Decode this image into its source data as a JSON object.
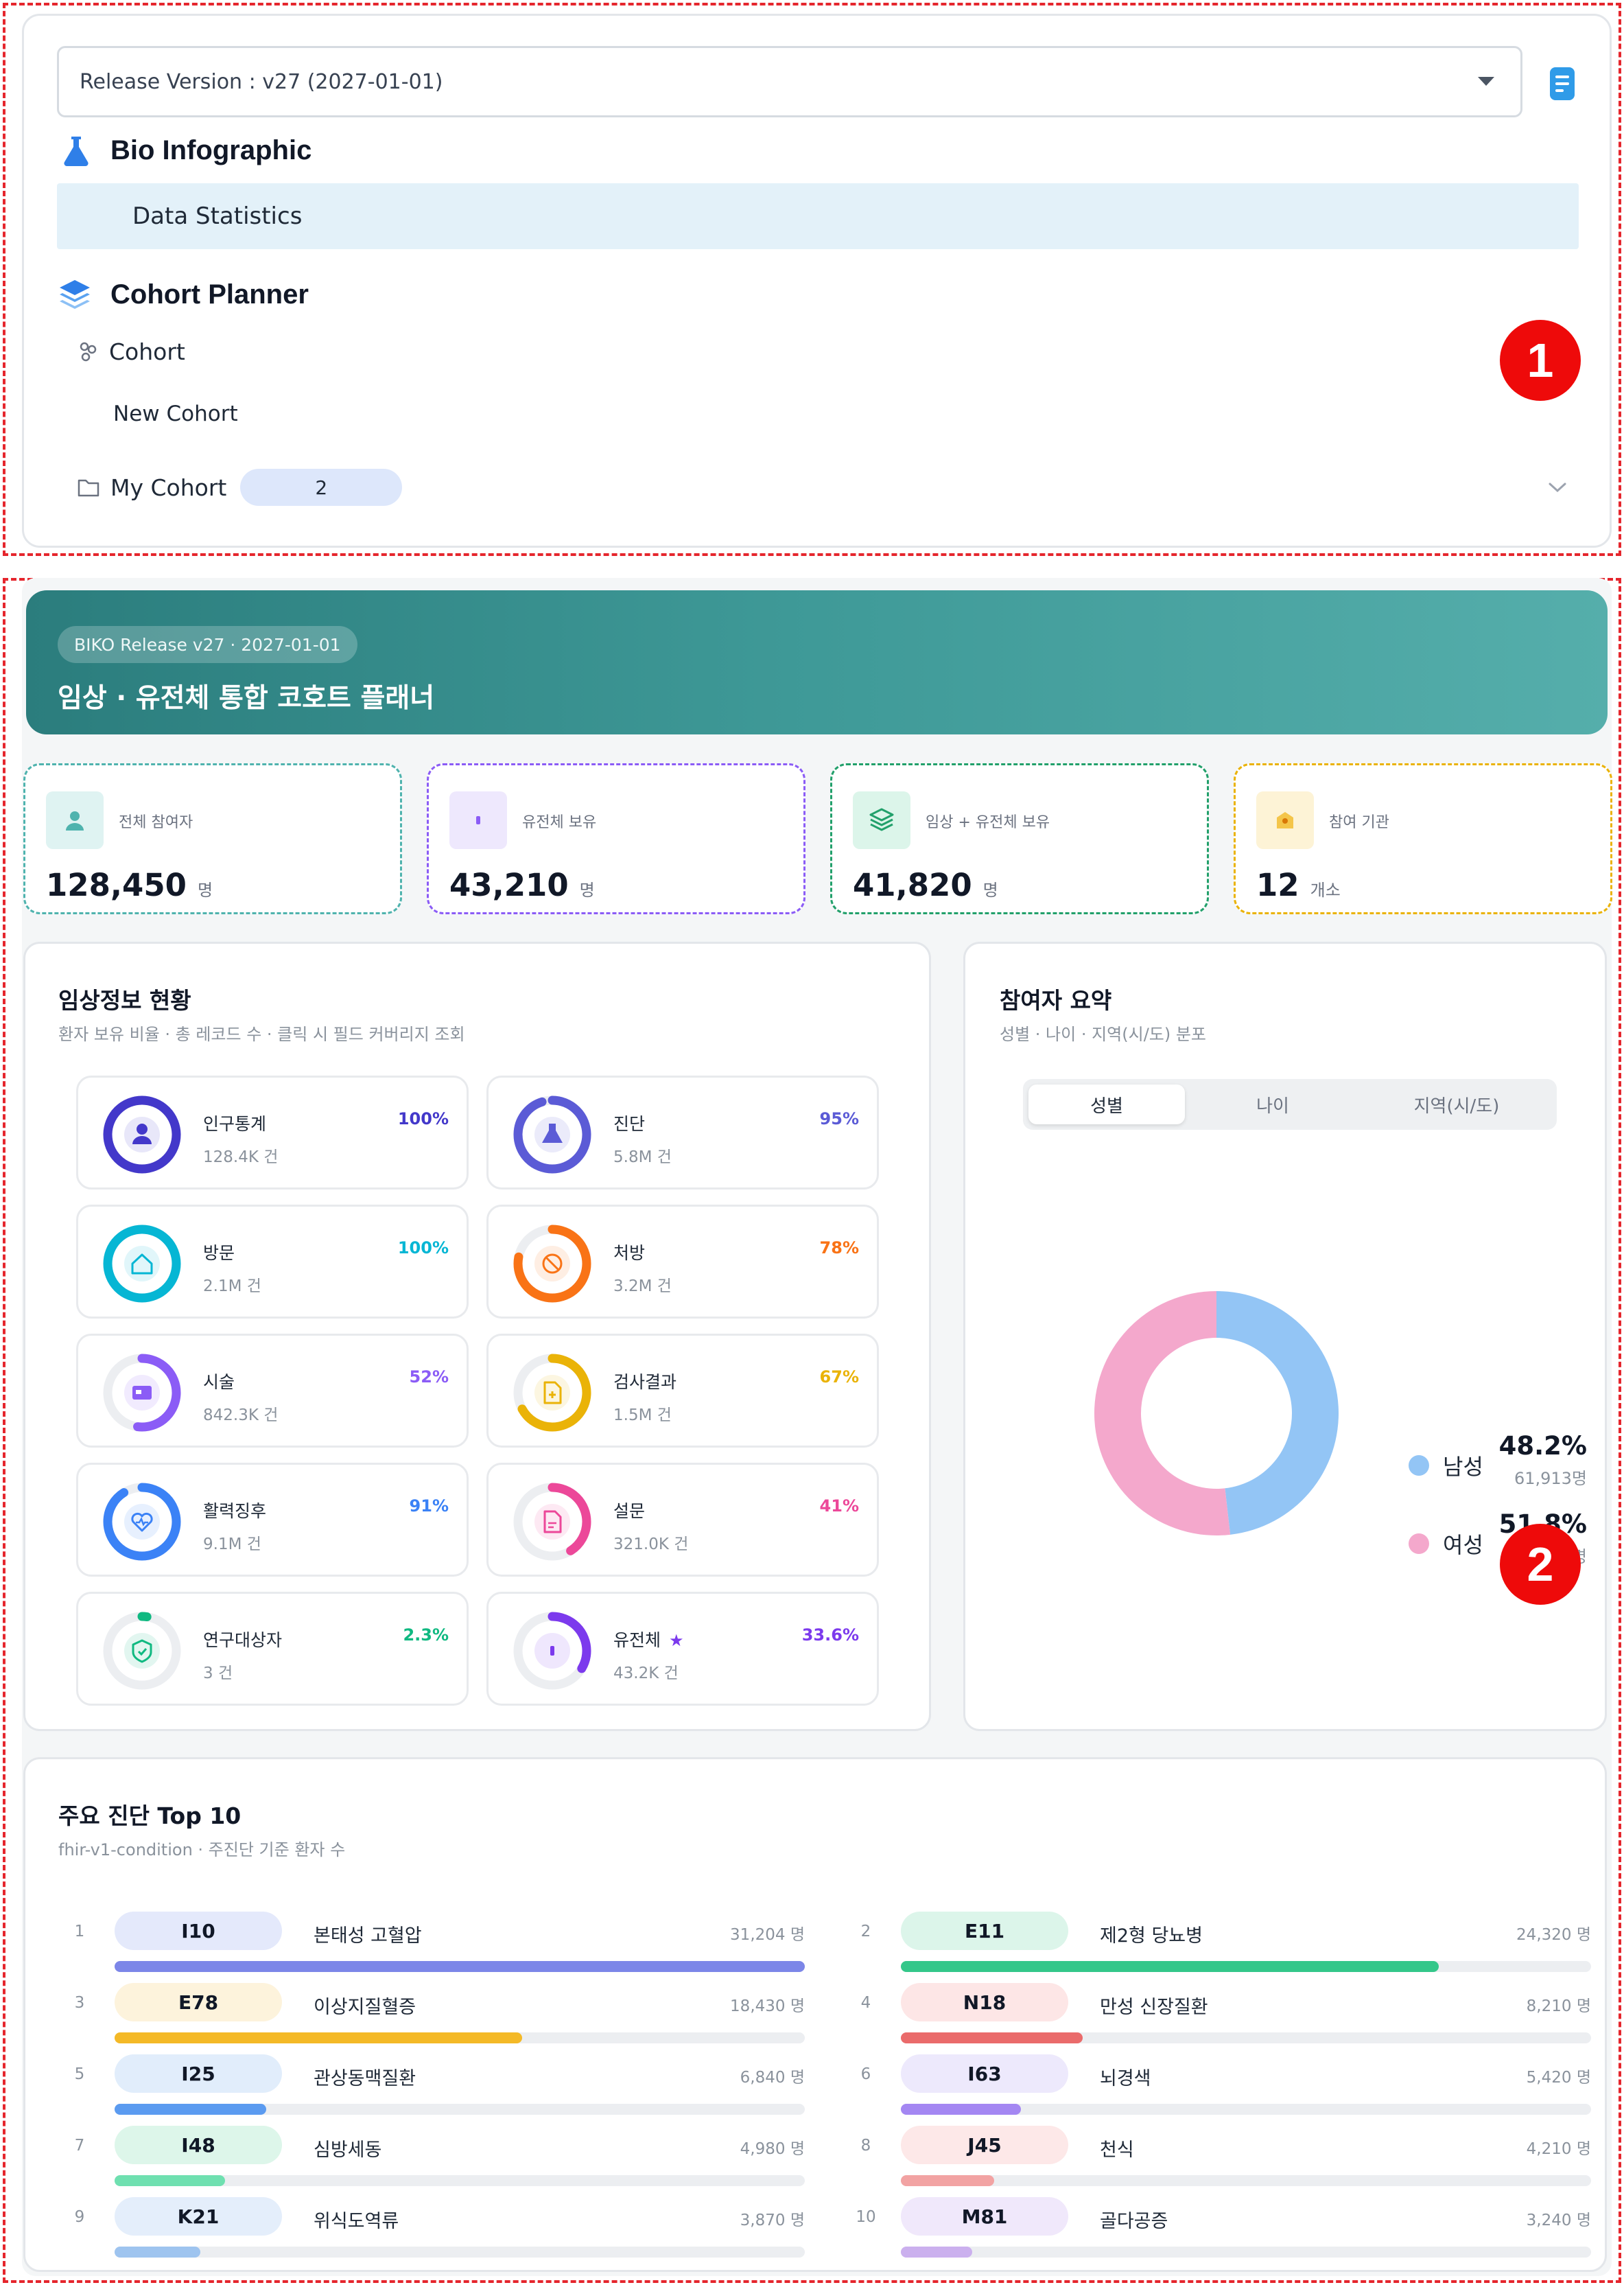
{
  "sidebar": {
    "release_select": "Release Version : v27 (2027-01-01)",
    "bio_infographic": {
      "title": "Bio Infographic",
      "items": [
        "Data Statistics"
      ]
    },
    "cohort_planner": {
      "title": "Cohort Planner",
      "cohort": "Cohort",
      "new_cohort": "New Cohort",
      "my_cohort": "My Cohort",
      "my_cohort_count": "2"
    }
  },
  "markers": {
    "one": "1",
    "two": "2"
  },
  "hero": {
    "pill": "BIKO Release v27 · 2027-01-01",
    "title": "임상 · 유전체 통합 코호트 플래너"
  },
  "stats": [
    {
      "label": "전체 참여자",
      "value": "128,450",
      "unit": "명",
      "color": "#4fb3ae"
    },
    {
      "label": "유전체 보유",
      "value": "43,210",
      "unit": "명",
      "color": "#8b5cf6"
    },
    {
      "label": "임상 + 유전체 보유",
      "value": "41,820",
      "unit": "명",
      "color": "#22a06b"
    },
    {
      "label": "참여 기관",
      "value": "12",
      "unit": "개소",
      "color": "#eab308"
    }
  ],
  "clinical": {
    "title": "임상정보 현황",
    "subtitle": "환자 보유 비율 · 총 레코드 수 · 클릭 시 필드 커버리지 조회",
    "tiles": [
      {
        "name": "인구통계",
        "count": "128.4K 건",
        "pct_label": "100%",
        "ratio": 1.0,
        "color": "#4338ca",
        "icon": "person-icon"
      },
      {
        "name": "진단",
        "count": "5.8M 건",
        "pct_label": "95%",
        "ratio": 0.95,
        "color": "#5b5bd6",
        "icon": "flask-icon"
      },
      {
        "name": "방문",
        "count": "2.1M 건",
        "pct_label": "100%",
        "ratio": 1.0,
        "color": "#06b6d4",
        "icon": "home-icon"
      },
      {
        "name": "처방",
        "count": "3.2M 건",
        "pct_label": "78%",
        "ratio": 0.78,
        "color": "#f97316",
        "icon": "prohibit-icon"
      },
      {
        "name": "시술",
        "count": "842.3K 건",
        "pct_label": "52%",
        "ratio": 0.52,
        "color": "#8b5cf6",
        "icon": "card-icon"
      },
      {
        "name": "검사결과",
        "count": "1.5M 건",
        "pct_label": "67%",
        "ratio": 0.67,
        "color": "#eab308",
        "icon": "doc-plus-icon"
      },
      {
        "name": "활력징후",
        "count": "9.1M 건",
        "pct_label": "91%",
        "ratio": 0.91,
        "color": "#3b82f6",
        "icon": "heart-pulse-icon"
      },
      {
        "name": "설문",
        "count": "321.0K 건",
        "pct_label": "41%",
        "ratio": 0.41,
        "color": "#ec4899",
        "icon": "survey-icon"
      },
      {
        "name": "연구대상자",
        "count": "3 건",
        "pct_label": "2.3%",
        "ratio": 0.023,
        "color": "#10b981",
        "icon": "shield-icon"
      },
      {
        "name": "유전체",
        "count": "43.2K 건",
        "pct_label": "33.6%",
        "ratio": 0.336,
        "color": "#7c3aed",
        "icon": "dna-icon",
        "star": "★"
      }
    ]
  },
  "participants": {
    "title": "참여자 요약",
    "subtitle": "성별 · 나이 · 지역(시/도) 분포",
    "tabs": [
      "성별",
      "나이",
      "지역(시/도)"
    ],
    "active_tab": 0,
    "donut": [
      {
        "label": "남성",
        "pct_label": "48.2%",
        "count": "61,913명",
        "ratio": 0.482,
        "color": "#93c5f5"
      },
      {
        "label": "여성",
        "pct_label": "51.8%",
        "count": "66,537명",
        "ratio": 0.518,
        "color": "#f4a8cc"
      }
    ]
  },
  "top10": {
    "title": "주요 진단 Top 10",
    "subtitle": "fhir-v1-condition · 주진단 기준 환자 수",
    "max": 31204,
    "items": [
      {
        "rank": "1",
        "code": "I10",
        "name": "본태성 고혈압",
        "count_label": "31,204 명",
        "count": 31204,
        "bg": "#e4e9fb",
        "bar": "#7c86e8"
      },
      {
        "rank": "2",
        "code": "E11",
        "name": "제2형 당뇨병",
        "count_label": "24,320 명",
        "count": 24320,
        "bg": "#dcf5ea",
        "bar": "#34c78a"
      },
      {
        "rank": "3",
        "code": "E78",
        "name": "이상지질혈증",
        "count_label": "18,430 명",
        "count": 18430,
        "bg": "#fdf3dc",
        "bar": "#f4b927"
      },
      {
        "rank": "4",
        "code": "N18",
        "name": "만성 신장질환",
        "count_label": "8,210 명",
        "count": 8210,
        "bg": "#fde6e6",
        "bar": "#ea6b6b"
      },
      {
        "rank": "5",
        "code": "I25",
        "name": "관상동맥질환",
        "count_label": "6,840 명",
        "count": 6840,
        "bg": "#e1edfb",
        "bar": "#5b9bf0"
      },
      {
        "rank": "6",
        "code": "I63",
        "name": "뇌경색",
        "count_label": "5,420 명",
        "count": 5420,
        "bg": "#ede9fc",
        "bar": "#a487f2"
      },
      {
        "rank": "7",
        "code": "I48",
        "name": "심방세동",
        "count_label": "4,980 명",
        "count": 4980,
        "bg": "#ddf6ea",
        "bar": "#6fe0b0"
      },
      {
        "rank": "8",
        "code": "J45",
        "name": "천식",
        "count_label": "4,210 명",
        "count": 4210,
        "bg": "#fde8e8",
        "bar": "#f2a3a3"
      },
      {
        "rank": "9",
        "code": "K21",
        "name": "위식도역류",
        "count_label": "3,870 명",
        "count": 3870,
        "bg": "#e4eefb",
        "bar": "#9ec4ef"
      },
      {
        "rank": "10",
        "code": "M81",
        "name": "골다공증",
        "count_label": "3,240 명",
        "count": 3240,
        "bg": "#f0e8fb",
        "bar": "#cbb0ee"
      }
    ]
  }
}
